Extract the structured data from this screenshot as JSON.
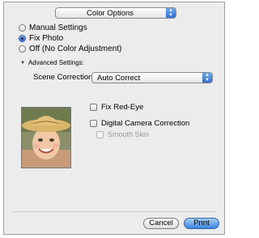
{
  "header": {
    "dropdown_value": "Color Options"
  },
  "options": {
    "manual": "Manual Settings",
    "fix_photo": "Fix Photo",
    "off": "Off (No Color Adjustment)",
    "selected": "fix_photo"
  },
  "advanced": {
    "label": "Advanced Settings:",
    "scene_label": "Scene Correction:",
    "scene_value": "Auto Correct"
  },
  "checkboxes": {
    "fix_red_eye": "Fix Red-Eye",
    "digital_camera": "Digital Camera Correction",
    "smooth_skin": "Smooth Skin"
  },
  "footer": {
    "cancel": "Cancel",
    "print": "Print"
  },
  "colors": {
    "accent": "#2f6fd0",
    "window_bg": "#ececec"
  }
}
